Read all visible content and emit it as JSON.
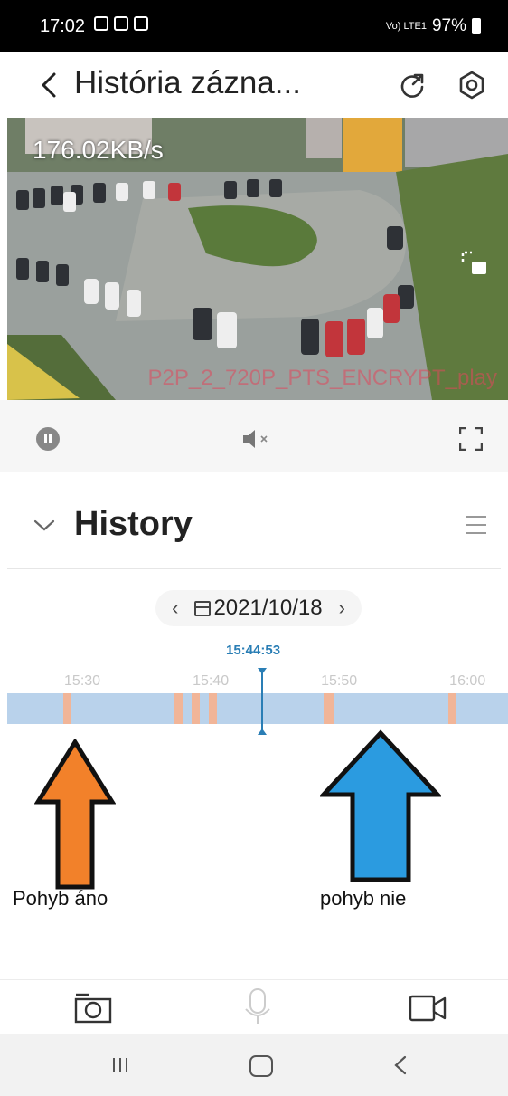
{
  "status_bar": {
    "time": "17:02",
    "network": "Vo) LTE1",
    "battery": "97%"
  },
  "header": {
    "title": "História zázna..."
  },
  "video": {
    "speed": "176.02KB/s",
    "watermark": "P2P_2_720P_PTS_ENCRYPT_play"
  },
  "history": {
    "title": "History",
    "date": "2021/10/18",
    "current_time": "15:44:53",
    "ticks": [
      "15:30",
      "15:40",
      "15:50",
      "16:00"
    ],
    "timeline_range": {
      "start": "15:25:00",
      "end": "16:04:00"
    },
    "motion_events": [
      {
        "start": "15:29:20",
        "end": "15:30:00"
      },
      {
        "start": "15:38:00",
        "end": "15:38:40"
      },
      {
        "start": "15:39:20",
        "end": "15:40:00"
      },
      {
        "start": "15:40:40",
        "end": "15:41:20"
      },
      {
        "start": "15:49:40",
        "end": "15:50:30"
      },
      {
        "start": "15:59:20",
        "end": "16:00:00"
      }
    ]
  },
  "annotations": {
    "yes_label": "Pohyb áno",
    "no_label": "pohyb nie",
    "yes_color": "#f2812a",
    "no_color": "#2b9be0"
  },
  "colors": {
    "timeline_band": "#b9d2eb",
    "motion_segment": "#f1b598",
    "playhead": "#2a7eb5"
  }
}
